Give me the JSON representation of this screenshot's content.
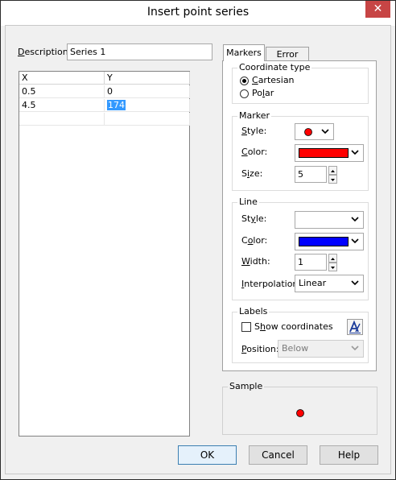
{
  "window": {
    "title": "Insert point series",
    "close_glyph": "✕"
  },
  "description": {
    "label_pre": "",
    "label_ul": "D",
    "label_post": "escription:",
    "value": "Series 1"
  },
  "table": {
    "headers": [
      "X",
      "Y"
    ],
    "rows": [
      [
        "0.5",
        "0"
      ],
      [
        "4.5",
        "174"
      ]
    ]
  },
  "tabs": {
    "markers": "Markers",
    "error_bars": "Error bars"
  },
  "coordinate_type": {
    "legend": "Coordinate type",
    "cartesian": {
      "pre": "",
      "ul": "C",
      "post": "artesian"
    },
    "polar": {
      "pre": "Po",
      "ul": "l",
      "post": "ar"
    }
  },
  "marker": {
    "legend": "Marker",
    "style_label": {
      "pre": "",
      "ul": "S",
      "post": "tyle:"
    },
    "color_label": {
      "pre": "",
      "ul": "C",
      "post": "olor:"
    },
    "size_label": {
      "pre": "S",
      "ul": "i",
      "post": "ze:"
    },
    "size_value": "5",
    "marker_color": "#ff0000",
    "style_icon": "red-dot-icon"
  },
  "line": {
    "legend": "Line",
    "style_label": {
      "pre": "St",
      "ul": "y",
      "post": "le:"
    },
    "color_label": {
      "pre": "C",
      "ul": "o",
      "post": "lor:"
    },
    "width_label": {
      "pre": "",
      "ul": "W",
      "post": "idth:"
    },
    "width_value": "1",
    "interp_label": {
      "pre": "",
      "ul": "I",
      "post": "nterpolation:"
    },
    "interp_value": "Linear",
    "line_color": "#0000ff"
  },
  "labels": {
    "legend": "Labels",
    "show_coords": {
      "pre": "S",
      "ul": "h",
      "post": "ow coordinates"
    },
    "font_icon": "font-icon",
    "position_label": {
      "pre": "",
      "ul": "P",
      "post": "osition:"
    },
    "position_value": "Below"
  },
  "sample": {
    "legend": "Sample",
    "marker_color": "#ff0000"
  },
  "buttons": {
    "ok": "OK",
    "cancel": "Cancel",
    "help": "Help"
  }
}
